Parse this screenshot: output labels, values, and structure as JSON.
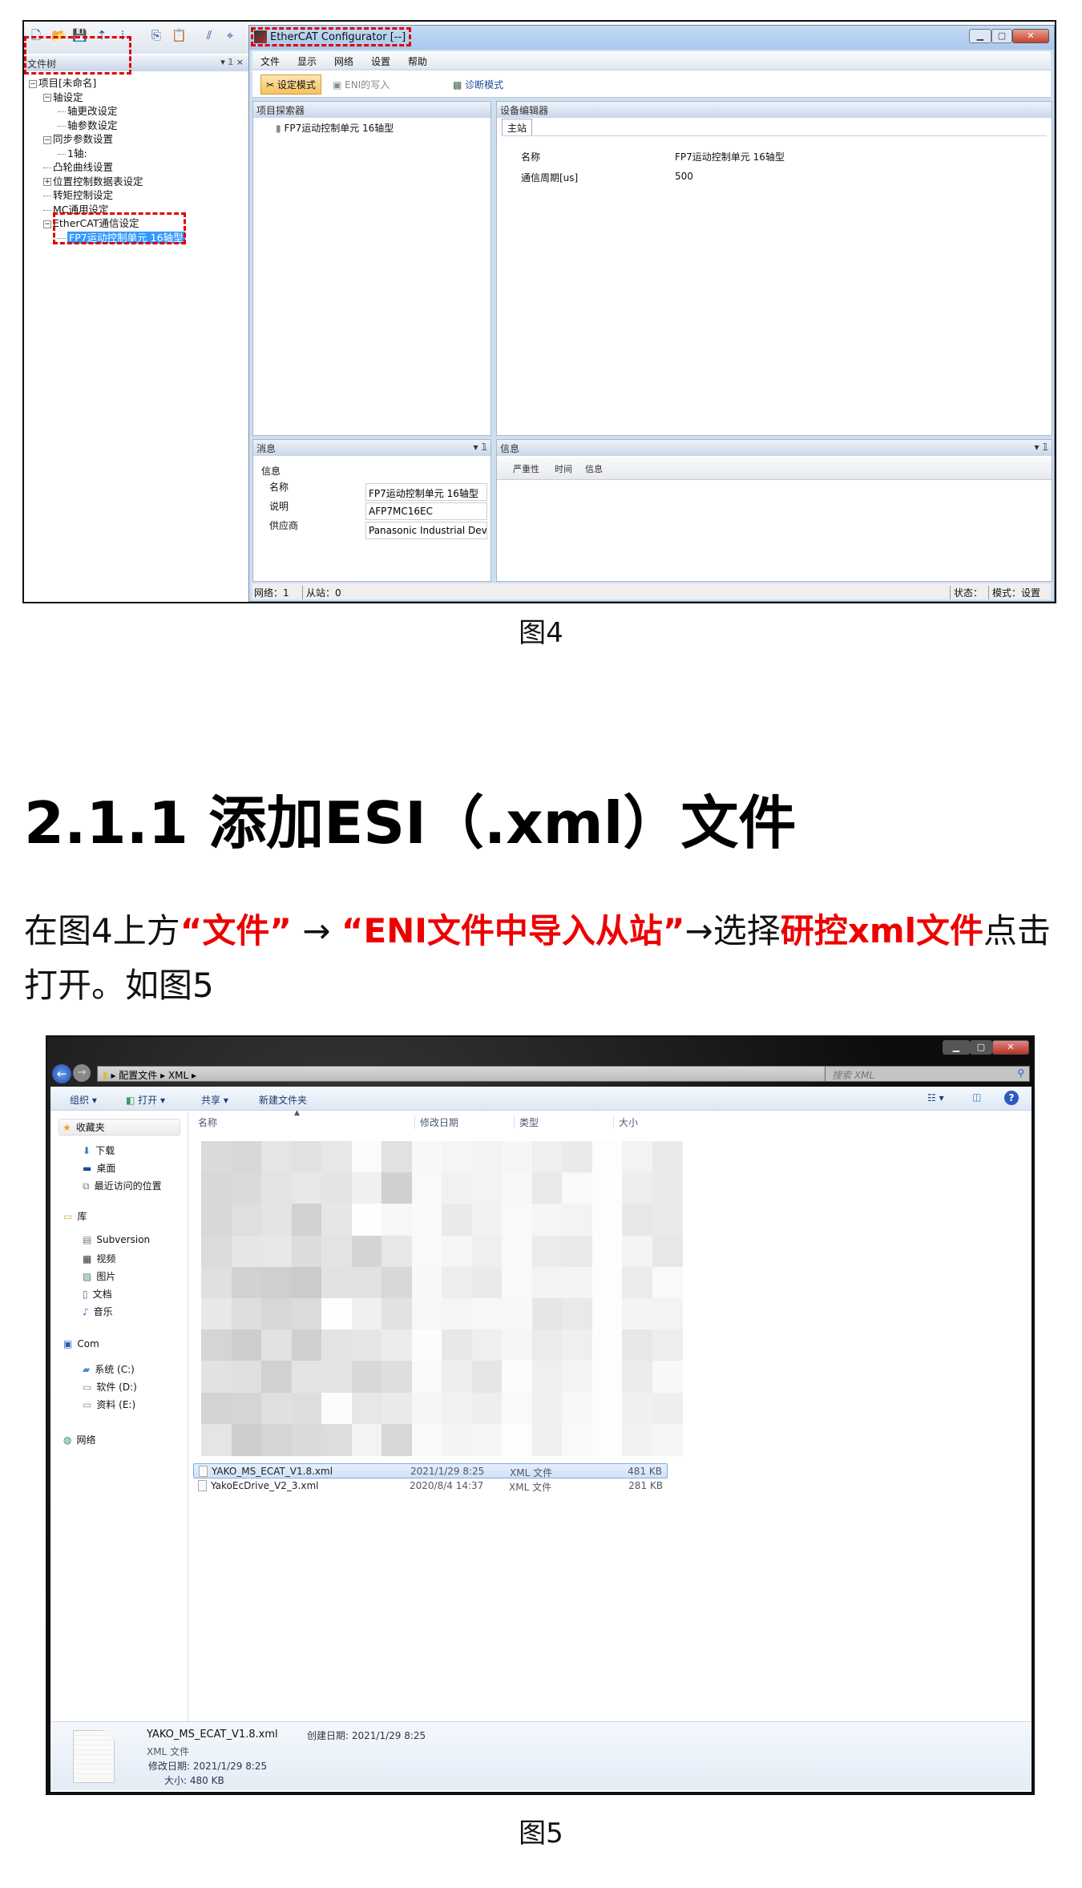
{
  "figure4": {
    "toolbar_icons": [
      "new-file-icon",
      "open-folder-icon",
      "save-icon",
      "upload-icon",
      "download-icon",
      "copy-icon",
      "paste-icon",
      "compile-icon",
      "debug-icon"
    ],
    "file_tree": {
      "header": "文件树",
      "items": [
        {
          "label": "项目[未命名]",
          "level": 0,
          "expander": "minus"
        },
        {
          "label": "轴设定",
          "level": 1,
          "expander": "minus"
        },
        {
          "label": "轴更改设定",
          "level": 2
        },
        {
          "label": "轴参数设定",
          "level": 2
        },
        {
          "label": "同步参数设置",
          "level": 1,
          "expander": "minus"
        },
        {
          "label": "1轴:",
          "level": 2
        },
        {
          "label": "凸轮曲线设置",
          "level": 1
        },
        {
          "label": "位置控制数据表设定",
          "level": 1,
          "expander": "plus"
        },
        {
          "label": "转矩控制设定",
          "level": 1
        },
        {
          "label": "MC通用设定",
          "level": 1
        },
        {
          "label": "EtherCAT通信设定",
          "level": 1,
          "expander": "minus"
        },
        {
          "label": "FP7运动控制单元 16轴型",
          "level": 2,
          "selected": true
        }
      ]
    },
    "window_title": "EtherCAT Configurator [--]",
    "menu": [
      "文件",
      "显示",
      "网络",
      "设置",
      "帮助"
    ],
    "toolbar": {
      "setup_mode": "设定模式",
      "eni_write": "ENI的写入",
      "diag_mode": "诊断模式"
    },
    "project_explorer": {
      "title": "项目探索器",
      "item": "FP7运动控制单元 16轴型"
    },
    "device_editor": {
      "title": "设备编辑器",
      "tab": "主站",
      "rows": [
        {
          "label": "名称",
          "value": "FP7运动控制单元 16轴型"
        },
        {
          "label": "通信周期[us]",
          "value": "500"
        }
      ]
    },
    "message_panel": {
      "title": "消息",
      "section": "信息",
      "rows": [
        {
          "label": "名称",
          "value": "FP7运动控制单元 16轴型"
        },
        {
          "label": "说明",
          "value": "AFP7MC16EC"
        },
        {
          "label": "供应商",
          "value": "Panasonic Industrial Devic"
        }
      ]
    },
    "info_panel": {
      "title": "信息",
      "columns": [
        "严重性",
        "时间",
        "信息"
      ]
    },
    "status": {
      "network": "网络：1",
      "slaves": "从站：0",
      "state": "状态：",
      "mode": "模式：设置"
    },
    "highlight_color": "#e00000",
    "caption": "图4"
  },
  "heading": "2.1.1 添加ESI（.xml）文件",
  "paragraph": [
    {
      "text": "在图4上方",
      "red": false
    },
    {
      "text": "“文件”",
      "red": true
    },
    {
      "text": " → ",
      "red": false
    },
    {
      "text": "“ENI文件中导入从站”",
      "red": true
    },
    {
      "text": "→选择",
      "red": false
    },
    {
      "text": "研控xml文件",
      "red": true
    },
    {
      "text": "点击打开。如图5",
      "red": false
    }
  ],
  "accent_red": "#ee0000",
  "figure5": {
    "breadcrumb": [
      "配置文件",
      "XML"
    ],
    "search_placeholder": "搜索 XML",
    "toolbar": {
      "organize": "组织 ▾",
      "open": "打开 ▾",
      "share": "共享 ▾",
      "new_folder": "新建文件夹"
    },
    "columns": {
      "name": "名称",
      "date": "修改日期",
      "type": "类型",
      "size": "大小"
    },
    "sidebar": [
      {
        "label": "收藏夹",
        "group": true,
        "icon": "star-icon"
      },
      {
        "label": "下载",
        "icon": "downloads-icon"
      },
      {
        "label": "桌面",
        "icon": "desktop-icon"
      },
      {
        "label": "最近访问的位置",
        "icon": "recent-places-icon"
      },
      {
        "label": "库",
        "group": true,
        "icon": "library-icon"
      },
      {
        "label": "Subversion",
        "icon": "document-library-icon"
      },
      {
        "label": "视频",
        "icon": "video-icon"
      },
      {
        "label": "图片",
        "icon": "pictures-icon"
      },
      {
        "label": "文档",
        "icon": "documents-icon"
      },
      {
        "label": "音乐",
        "icon": "music-icon"
      },
      {
        "label": "Com",
        "group": true,
        "icon": "computer-icon"
      },
      {
        "label": "系统 (C:)",
        "icon": "system-drive-icon"
      },
      {
        "label": "软件 (D:)",
        "icon": "drive-icon"
      },
      {
        "label": "资料 (E:)",
        "icon": "drive-icon"
      },
      {
        "label": "网络",
        "group": true,
        "icon": "network-icon"
      }
    ],
    "files": [
      {
        "name": "YAKO_MS_ECAT_V1.8.xml",
        "date": "2021/1/29 8:25",
        "type": "XML 文件",
        "size": "481 KB",
        "selected": true
      },
      {
        "name": "YakoEcDrive_V2_3.xml",
        "date": "2020/8/4 14:37",
        "type": "XML 文件",
        "size": "281 KB"
      }
    ],
    "details": {
      "name": "YAKO_MS_ECAT_V1.8.xml",
      "type": "XML 文件",
      "modified": "修改日期: 2021/1/29 8:25",
      "size": "大小: 480 KB",
      "created": "创建日期: 2021/1/29 8:25"
    },
    "caption": "图5"
  }
}
